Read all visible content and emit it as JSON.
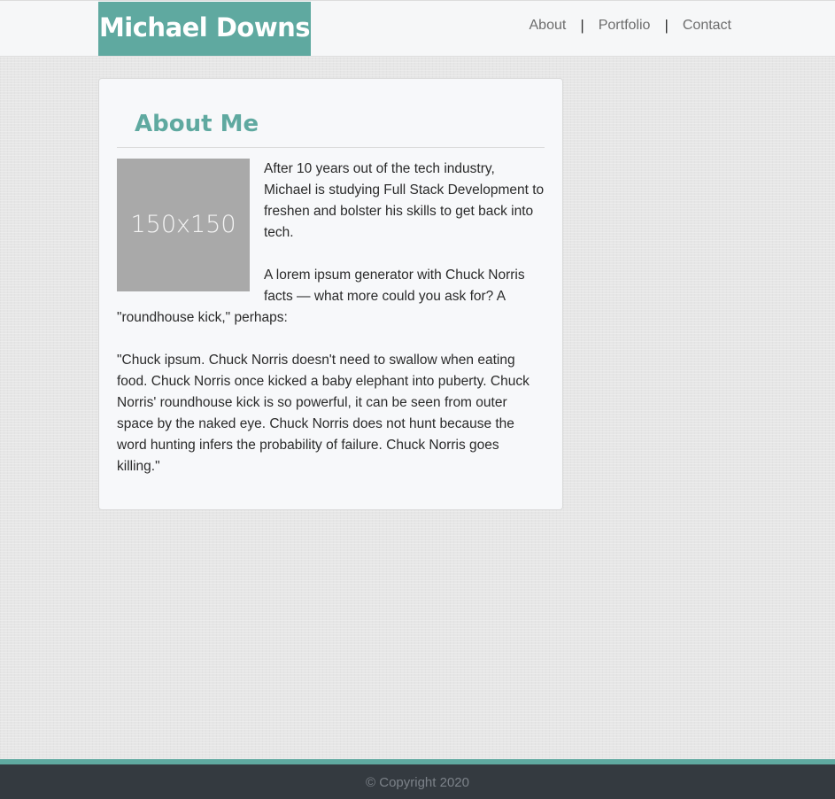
{
  "header": {
    "brand": "Michael Downs",
    "nav": [
      {
        "label": "About"
      },
      {
        "label": "Portfolio"
      },
      {
        "label": "Contact"
      }
    ],
    "separator": "|"
  },
  "about": {
    "title": "About Me",
    "image_placeholder": "150x150",
    "paragraphs": [
      "After 10 years out of the tech industry, Michael is studying Full Stack Development to freshen and bolster his skills to get back into tech.",
      "A lorem ipsum generator with Chuck Norris facts — what more could you ask for? A \"roundhouse kick,\" perhaps:",
      "\"Chuck ipsum. Chuck Norris doesn't need to swallow when eating food. Chuck Norris once kicked a baby elephant into puberty. Chuck Norris' roundhouse kick is so powerful, it can be seen from outer space by the naked eye. Chuck Norris does not hunt because the word hunting infers the probability of failure. Chuck Norris goes killing.\""
    ]
  },
  "footer": {
    "copyright": "© Copyright 2020"
  },
  "colors": {
    "accent": "#5fa9a0",
    "footer_bg": "#343a40",
    "card_bg": "#f7f8fa"
  }
}
